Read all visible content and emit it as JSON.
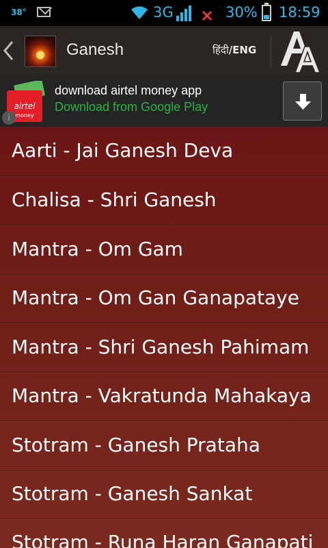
{
  "status_bar": {
    "temperature": "38°",
    "network_type": "3G",
    "battery_percent": "30%",
    "time": "18:59",
    "icons": [
      "temperature-icon",
      "mail-icon",
      "wifi-icon",
      "signal-icon",
      "no-sim-icon",
      "battery-icon"
    ]
  },
  "action_bar": {
    "title": "Ganesh",
    "lang_hindi": "हिंदी",
    "lang_sep_eng": "/ENG",
    "icons": [
      "back-chevron-icon",
      "app-icon",
      "font-size-icon"
    ]
  },
  "ad": {
    "title": "download airtel money app",
    "subtitle": "Download from Google Play",
    "brand_color": "#2db043",
    "icons": [
      "airtel-money-logo",
      "ad-info-icon",
      "download-arrow-icon"
    ]
  },
  "list": {
    "items": [
      "Aarti - Jai Ganesh Deva",
      "Chalisa - Shri Ganesh",
      "Mantra - Om Gam",
      "Mantra - Om Gan Ganapataye",
      "Mantra - Shri Ganesh Pahimam",
      "Mantra - Vakratunda Mahakaya",
      "Stotram - Ganesh Prataha",
      "Stotram - Ganesh Sankat",
      "Stotram - Runa Haran Ganapati"
    ]
  },
  "colors": {
    "accent": "#33b5e5",
    "list_background": "#6b1616",
    "action_bar": "#2b2624"
  }
}
